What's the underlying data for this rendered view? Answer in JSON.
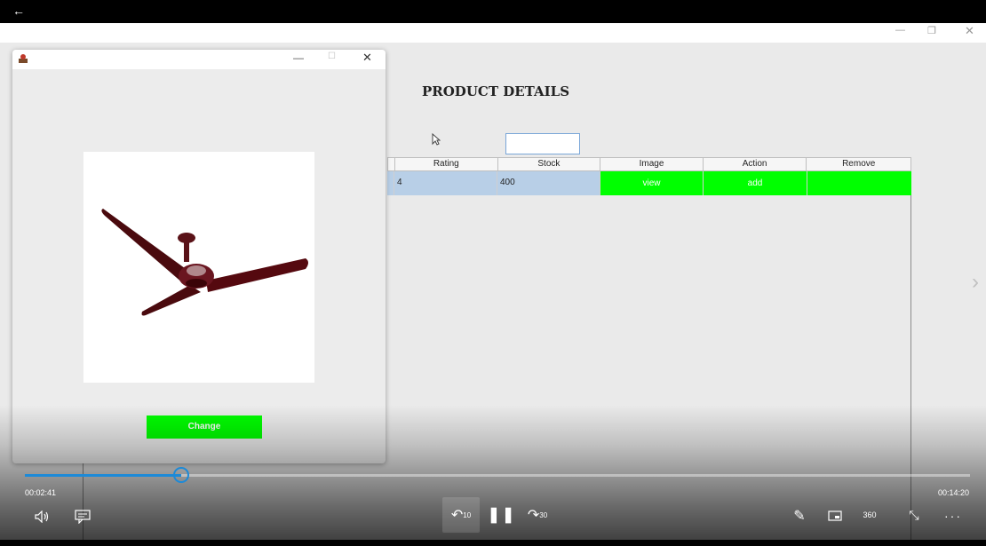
{
  "player": {
    "elapsed_time": "00:02:41",
    "total_time": "00:14:20",
    "progress_fraction": 0.165,
    "accent_color": "#1c8ad8",
    "controls": {
      "back": "←",
      "volume_icon": "volume-icon",
      "captions_icon": "captions-icon",
      "skip_back_label": "10",
      "pause_icon": "pause-icon",
      "skip_forward_label": "30",
      "pen_icon": "pen-icon",
      "mini_player_icon": "mini-player-icon",
      "vr_label": "360",
      "exit_fullscreen_icon": "exit-fullscreen-icon",
      "more_icon": "more-icon"
    }
  },
  "app_window": {
    "title": "PRODUCT DETAILS",
    "table": {
      "columns": [
        "Rating",
        "Stock",
        "Image",
        "Action",
        "Remove"
      ],
      "rows": [
        {
          "rating": "4",
          "stock": "400",
          "image": "view",
          "action": "add",
          "remove": ""
        }
      ],
      "highlight_color": "#00ff00",
      "selection_color": "#b8cfe7"
    }
  },
  "popup": {
    "image_subject": "ceiling-fan-image",
    "change_button": "Change"
  }
}
